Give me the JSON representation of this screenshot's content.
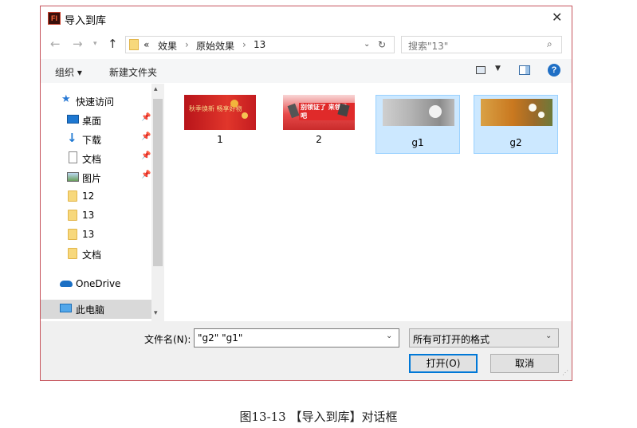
{
  "dialog": {
    "title": "导入到库",
    "address": {
      "prefix": "«",
      "crumbs": [
        "效果",
        "原始效果",
        "13"
      ]
    },
    "search": {
      "placeholder": "搜索\"13\""
    },
    "toolbar": {
      "organize": "组织 ▾",
      "new_folder": "新建文件夹"
    },
    "sidebar": {
      "items": [
        {
          "label": "快速访问",
          "icon": "star-icon"
        },
        {
          "label": "桌面",
          "icon": "desktop-icon",
          "pinned": true
        },
        {
          "label": "下载",
          "icon": "download-icon",
          "pinned": true
        },
        {
          "label": "文档",
          "icon": "document-icon",
          "pinned": true
        },
        {
          "label": "图片",
          "icon": "pictures-icon",
          "pinned": true
        },
        {
          "label": "12",
          "icon": "folder-icon"
        },
        {
          "label": "13",
          "icon": "folder-icon"
        },
        {
          "label": "13",
          "icon": "folder-icon"
        },
        {
          "label": "文档",
          "icon": "folder-icon"
        },
        {
          "label": "OneDrive",
          "icon": "cloud-icon"
        },
        {
          "label": "此电脑",
          "icon": "computer-icon",
          "selected": true
        }
      ]
    },
    "files": [
      {
        "name": "1",
        "selected": false
      },
      {
        "name": "2",
        "selected": false
      },
      {
        "name": "g1",
        "selected": true
      },
      {
        "name": "g2",
        "selected": true
      }
    ],
    "filename": {
      "label": "文件名(N):",
      "value": "\"g2\" \"g1\""
    },
    "filetype": {
      "value": "所有可打开的格式"
    },
    "buttons": {
      "open": "打开(O)",
      "cancel": "取消"
    },
    "thumb_texts": {
      "t1": "秋季焕新 畅享好物",
      "t2": "别领证了 来领券吧"
    }
  },
  "caption": "图13-13 【导入到库】对话框",
  "colors": {
    "accent": "#0078d7",
    "selection": "#cce8ff",
    "border": "#c6545c"
  }
}
